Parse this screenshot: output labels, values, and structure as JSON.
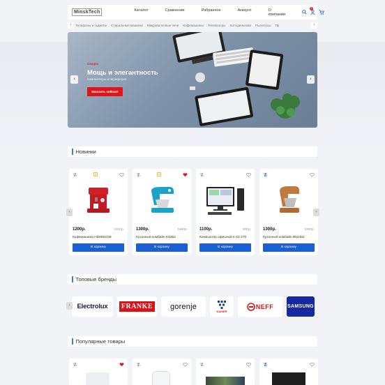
{
  "header": {
    "logo": "MinskTech",
    "nav": [
      "Каталог",
      "Сравнение",
      "Избранное",
      "Аккаунт",
      "О компании"
    ],
    "cart_count": "1"
  },
  "categories": [
    "Телефоны и гаджеты",
    "Стиральные машины",
    "Микроволновые печи",
    "Кофемашины",
    "Телевизоры",
    "Холодильники",
    "Пылесосы",
    "Пр"
  ],
  "banner": {
    "tag": "Скидки",
    "title": "Мощь и элегантность",
    "subtitle": "Компьютеры и периферия",
    "button": "Заказать сейчас!"
  },
  "new_section": {
    "title": "Новинки",
    "products": [
      {
        "price": "1200р.",
        "old_price": "1600р.",
        "name": "Кофемашина HD8654/39",
        "button": "В корзину",
        "icon": "coffee-machine-icon",
        "liked": false
      },
      {
        "price": "1300р.",
        "old_price": "1900р.",
        "name": "Кухонный комбайн K6352",
        "button": "В корзину",
        "icon": "stand-mixer-icon",
        "liked": true
      },
      {
        "price": "1100р.",
        "old_price": "900р.",
        "name": "Компьютер офисный II X2 270",
        "button": "В корзину",
        "icon": "desktop-pc-icon",
        "liked": false
      },
      {
        "price": "1300р.",
        "old_price": "1900р.",
        "name": "Кухонный комбайн B52452",
        "button": "В корзину",
        "icon": "stand-mixer-icon",
        "liked": false
      }
    ]
  },
  "brands_section": {
    "title": "Топовые бренды",
    "brands": [
      "Electrolux",
      "FRANKE",
      "gorenje",
      "KAISER",
      "NEFF",
      "SAMSUNG"
    ]
  },
  "popular_section": {
    "title": "Популярные товары"
  },
  "colors": {
    "accent": "#1a5fd6",
    "sale": "#e0141c",
    "bar": "#3b82c4"
  }
}
